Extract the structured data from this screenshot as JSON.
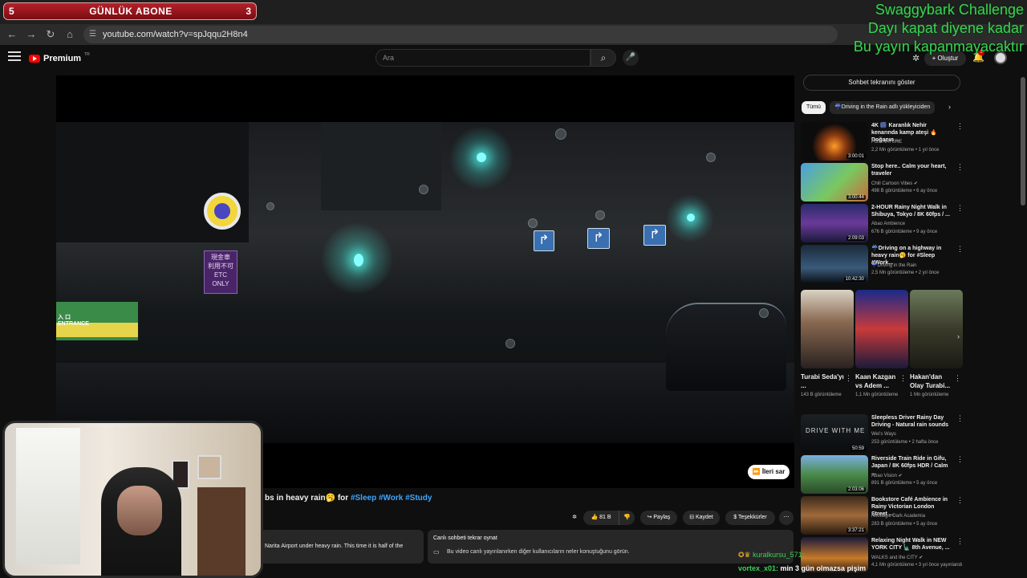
{
  "overlay": {
    "sub_counter": {
      "left_value": "5",
      "title": "GÜNLÜK ABONE",
      "right_value": "3"
    },
    "challenge_lines": [
      "Swaggybark Challenge",
      "Dayı kapat diyene kadar",
      "Bu yayın kapanmayacaktır"
    ]
  },
  "browser": {
    "url": "youtube.com/watch?v=spJqqu2H8n4",
    "back_icon": "arrow-left-icon",
    "forward_icon": "arrow-right-icon",
    "reload_icon": "reload-icon",
    "home_icon": "home-icon"
  },
  "header": {
    "logo_text": "Premium",
    "logo_region": "TR",
    "search_placeholder": "Ara",
    "create_label": "Oluştur",
    "notification_count": "3"
  },
  "video": {
    "sign_text": "現金車\n利用不可\nETC\nONLY",
    "entrance_text": "入 口\nENTRANCE",
    "skip_label": "İleri sar",
    "title_prefix": "bs in heavy rain🥱 for ",
    "title_tags": "#Sleep #Work #Study",
    "likes": "81 B",
    "share_label": "Paylaş",
    "save_label": "Kaydet",
    "thanks_label": "Teşekkürler",
    "description_snippet": "Narita Airport under heavy rain. This time it is half of the",
    "chat_replay_title": "Canlı sohbeti tekrar oynat",
    "chat_replay_sub": "Bu video canlı yayınlanırken diğer kullanıcıların neler konuştuğunu görün."
  },
  "sidebar": {
    "chat_toggle": "Sohbet tekranını göster",
    "chips": [
      "Tümü",
      "Driving in the Rain adlı yükleyiciden"
    ],
    "recs_top": [
      {
        "title": "4K 🎆 Karanlık Nehir kenarında kamp ateşi 🔥 Doğanın ...",
        "channel": "FOX NATURE",
        "meta": "2,2 Mn görüntüleme • 1 yıl önce",
        "duration": "3:00:01"
      },
      {
        "title": "Stop here.. Calm your heart, traveler",
        "channel": "Chill Cartoon Vibes ✔",
        "meta": "498 B görüntüleme • 6 ay önce",
        "duration": "3:00:44"
      },
      {
        "title": "2-HOUR Rainy Night Walk in Shibuya, Tokyo / 8K 60fps / ...",
        "channel": "Abao Ambience",
        "meta": "676 B görüntüleme • 9 ay önce",
        "duration": "2:09:03"
      },
      {
        "title": "☔Driving on a highway in heavy rain🥱 for #Sleep #Work...",
        "channel": "☔Driving in the Rain",
        "meta": "2,5 Mn görüntüleme • 2 yıl önce",
        "duration": "10:42:30"
      }
    ],
    "shorts": [
      {
        "title": "Turabi Seda'yı ...",
        "views": "143 B görüntüleme"
      },
      {
        "title": "Kaan Kazgan vs Adem ...",
        "views": "1,1 Mn görüntüleme"
      },
      {
        "title": "Hakan'dan Olay Turabi...",
        "views": "1 Mn görüntüleme"
      }
    ],
    "recs_bottom": [
      {
        "title": "Sleepless Driver Rainy Day Driving - Natural rain sounds",
        "channel": "Wei's Ways",
        "meta": "253 görüntüleme • 2 hafta önce",
        "duration": "50:59"
      },
      {
        "title": "Riverside Train Ride in Gifu, Japan / 8K 60fps HDR / Calm ...",
        "channel": "Abao Vision ✔",
        "meta": "891 B görüntüleme • 5 ay önce",
        "duration": "2:03:06"
      },
      {
        "title": "Bookstore Café Ambience in Rainy Victorian London Street ...",
        "channel": "Nostalgic Dark Academia",
        "meta": "283 B görüntüleme • 5 ay önce",
        "duration": "3:37:21"
      },
      {
        "title": "Relaxing Night Walk in NEW YORK CITY 🗽 8th Avenue, ...",
        "channel": "WALKS and the CITY ✔",
        "meta": "4,1 Mn görüntüleme • 3 yıl önce yayınlandı",
        "duration": ""
      }
    ],
    "thumb_text_drive": "DRIVE WITH ME"
  },
  "chat": {
    "line1_user": "kuralkursu_571:",
    "line2_user": "vortex_x01:",
    "line2_text": " min 3 gün olmazsa pişim"
  },
  "colors": {
    "accent_green": "#39d353",
    "youtube_red": "#ff0000",
    "link_blue": "#3ea6ff"
  }
}
